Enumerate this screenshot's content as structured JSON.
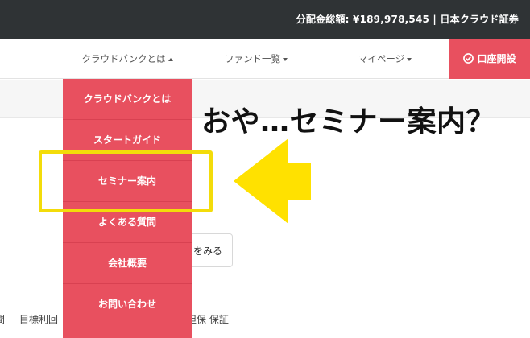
{
  "topbar": {
    "text": "分配金総額: ¥189,978,545 | 日本クラウド証券"
  },
  "nav": {
    "about": "クラウドバンクとは",
    "funds": "ファンド一覧",
    "mypage": "マイページ",
    "cta": "口座開設"
  },
  "dropdown": {
    "items": [
      {
        "label": "クラウドバンクとは"
      },
      {
        "label": "スタートガイド"
      },
      {
        "label": "セミナー案内"
      },
      {
        "label": "よくある質問"
      },
      {
        "label": "会社概要"
      },
      {
        "label": "お問い合わせ"
      }
    ]
  },
  "background": {
    "button_label": "をみる",
    "bottom_left": "間",
    "bottom_mid": "目標利回",
    "bottom_right": "担保 保証"
  },
  "annotation": {
    "text": "おや…セミナー案内？",
    "highlight_color": "#f3dc0a",
    "arrow_color": "#ffe100"
  },
  "colors": {
    "topbar": "#2f3335",
    "accent": "#e8505f"
  }
}
